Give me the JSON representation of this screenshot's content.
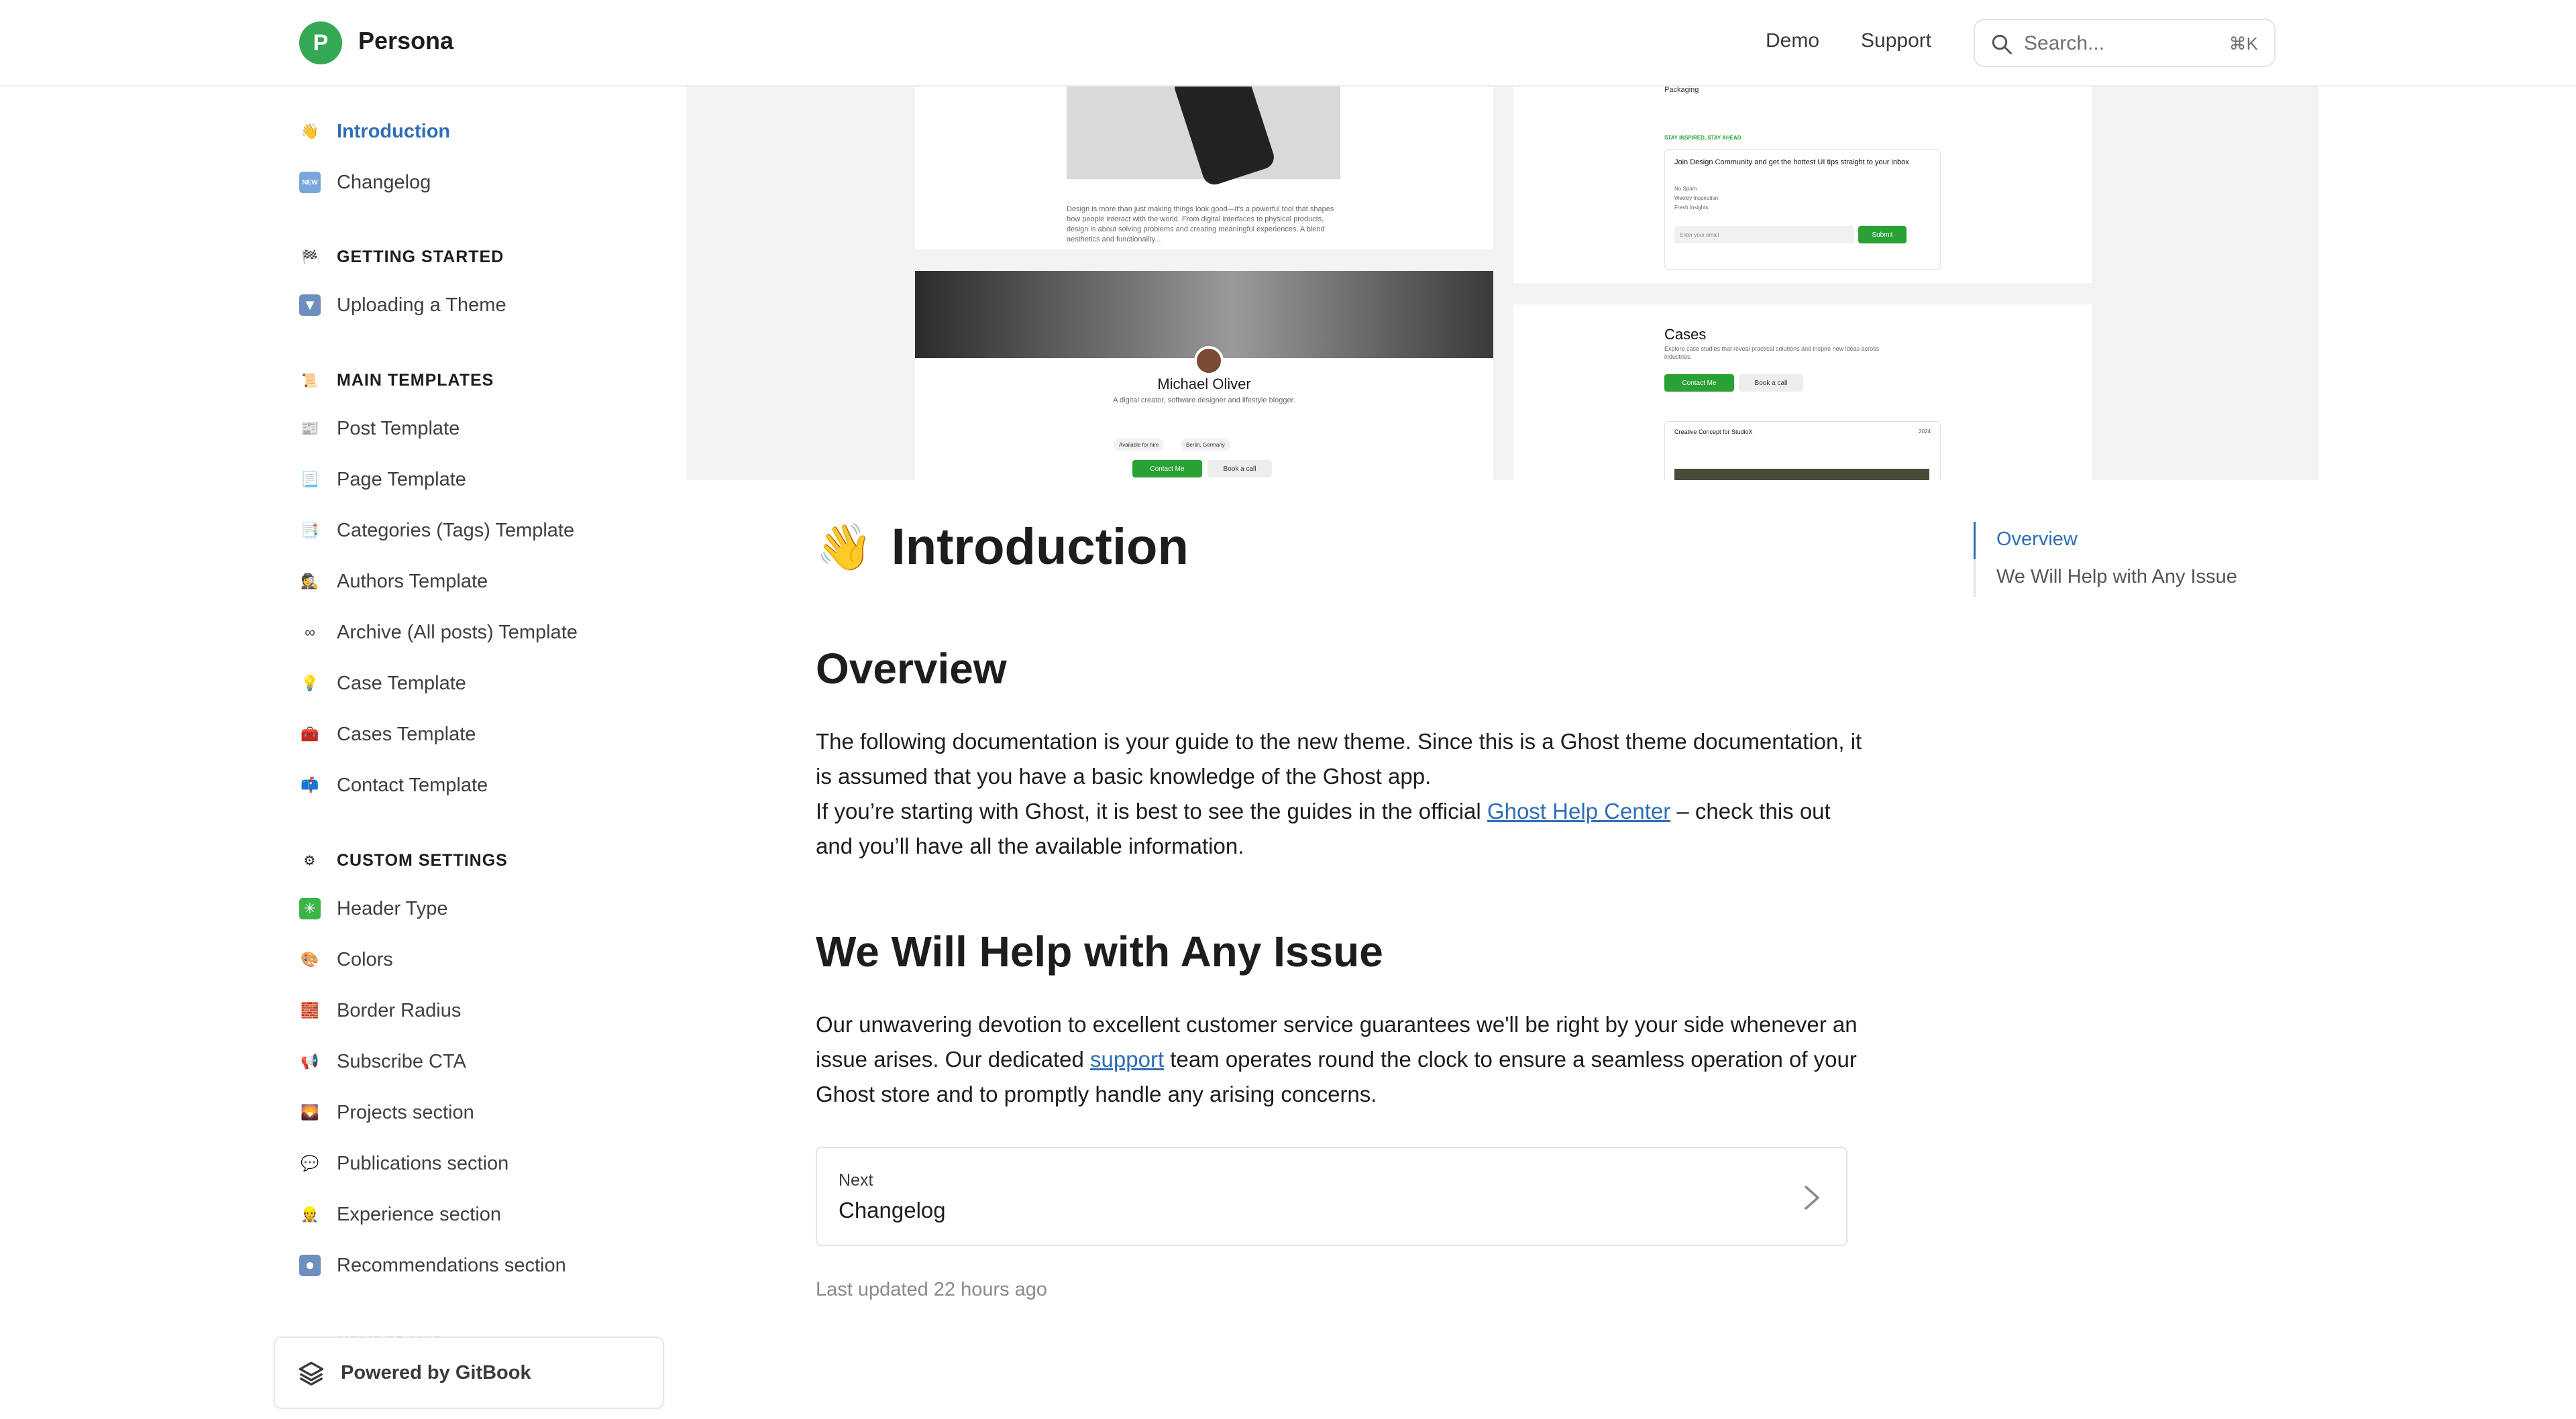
{
  "header": {
    "logo_letter": "P",
    "brand": "Persona",
    "nav": [
      "Demo",
      "Support"
    ],
    "search_placeholder": "Search...",
    "search_shortcut": "⌘K"
  },
  "sidebar": {
    "top_items": [
      {
        "icon": "waving-hand-icon",
        "label": "Introduction",
        "active": true
      },
      {
        "icon": "new-badge-icon",
        "label": "Changelog",
        "active": false
      }
    ],
    "sections": [
      {
        "title": "GETTING STARTED",
        "icon": "checkered-flag-icon",
        "items": [
          {
            "icon": "download-arrow-icon",
            "label": "Uploading a Theme"
          }
        ]
      },
      {
        "title": "MAIN TEMPLATES",
        "icon": "scroll-icon",
        "items": [
          {
            "icon": "newspaper-icon",
            "label": "Post Template"
          },
          {
            "icon": "page-icon",
            "label": "Page Template"
          },
          {
            "icon": "bookmark-tabs-icon",
            "label": "Categories (Tags) Template"
          },
          {
            "icon": "detective-icon",
            "label": "Authors Template"
          },
          {
            "icon": "infinity-icon",
            "label": "Archive (All posts) Template"
          },
          {
            "icon": "light-bulb-icon",
            "label": "Case Template"
          },
          {
            "icon": "toolbox-icon",
            "label": "Cases Template"
          },
          {
            "icon": "mailbox-icon",
            "label": "Contact Template"
          }
        ]
      },
      {
        "title": "CUSTOM SETTINGS",
        "icon": "gear-icon",
        "items": [
          {
            "icon": "sparkle-icon",
            "label": "Header Type"
          },
          {
            "icon": "palette-icon",
            "label": "Colors"
          },
          {
            "icon": "brick-icon",
            "label": "Border Radius"
          },
          {
            "icon": "megaphone-icon",
            "label": "Subscribe CTA"
          },
          {
            "icon": "picture-icon",
            "label": "Projects section"
          },
          {
            "icon": "speech-bubble-icon",
            "label": "Publications section"
          },
          {
            "icon": "worker-icon",
            "label": "Experience section"
          },
          {
            "icon": "record-button-icon",
            "label": "Recommendations section"
          }
        ]
      }
    ],
    "faded_heading": "MEMBERSHIP",
    "powered_by": "Powered by GitBook"
  },
  "hero_preview": {
    "blog_text": "Design is more than just making things look good—it's a powerful tool that shapes how people interact with the world. From digital interfaces to physical products, design is about solving problems and creating meaningful experiences. A blend aesthetics and functionality...",
    "profile_name": "Michael Oliver",
    "profile_bio": "A digital creator, software designer and lifestyle blogger.",
    "chips": [
      "Available for hire",
      "Berlin, Germany"
    ],
    "contact_button": "Contact Me",
    "book_button": "Book a call",
    "packaging_label": "Packaging",
    "newsletter_heading": "STAY INSPIRED, STAY AHEAD",
    "newsletter_title": "Join Design Community and get the hottest UI tips straight to your inbox",
    "newsletter_bullets": [
      "No Spam",
      "Weekly Inspiration",
      "Fresh Insights"
    ],
    "email_placeholder": "Enter your email",
    "submit_button": "Submit",
    "cases_title": "Cases",
    "cases_sub": "Explore case studies that reveal practical solutions and inspire new ideas across industries.",
    "case_item_title": "Creative Concept for StudioX",
    "case_item_year": "2024"
  },
  "main": {
    "title_emoji": "👋",
    "title": "Introduction",
    "overview_heading": "Overview",
    "overview_p1": "The following documentation is your guide to the new theme. Since this is a Ghost theme documentation, it is assumed that you have a basic knowledge of the Ghost app.",
    "overview_p2_before": "If you’re starting with Ghost, it is best to see the guides in the official ",
    "overview_link": "Ghost Help Center",
    "overview_p2_after": " – check this out and you’ll have all the available information.",
    "help_heading": "We Will Help with Any Issue",
    "help_before": "Our unwavering devotion to excellent customer service guarantees we'll be right by your side whenever an issue arises. Our dedicated ",
    "help_link": "support",
    "help_after": " team operates round the clock to ensure a seamless operation of your Ghost store and to promptly handle any arising concerns.",
    "next_label": "Next",
    "next_title": "Changelog",
    "last_updated": "Last updated 22 hours ago"
  },
  "toc": {
    "items": [
      {
        "label": "Overview",
        "active": true
      },
      {
        "label": "We Will Help with Any Issue",
        "active": false
      }
    ]
  },
  "colors": {
    "accent": "#2f6db6",
    "brand_green": "#34a853",
    "cta_green": "#2aa135"
  }
}
